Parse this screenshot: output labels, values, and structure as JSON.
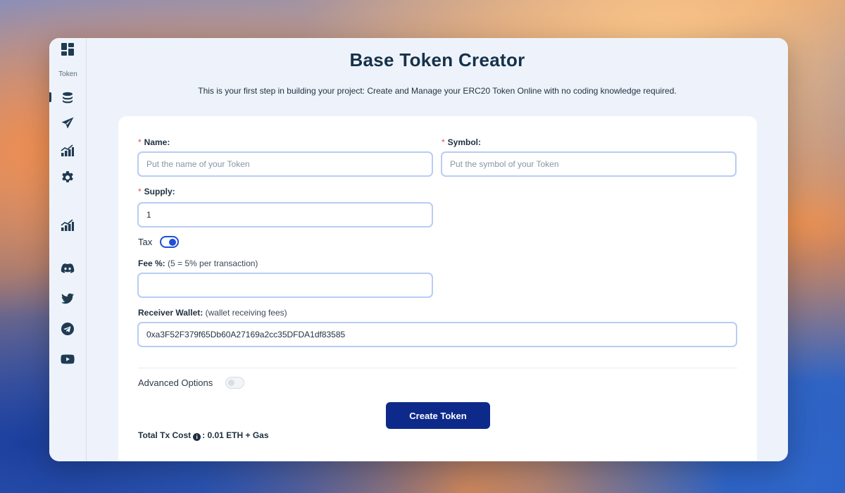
{
  "sidebar": {
    "section_label": "Token",
    "icons": [
      "dashboard-icon",
      "coins-icon",
      "send-icon",
      "chart-icon",
      "gear-icon",
      "chart-icon-2",
      "discord-icon",
      "twitter-icon",
      "telegram-icon",
      "youtube-icon"
    ]
  },
  "header": {
    "title": "Base Token Creator",
    "subtitle": "This is your first step in building your project: Create and Manage your ERC20 Token Online with no coding knowledge required."
  },
  "form": {
    "required_mark": "*",
    "name_label": "Name:",
    "name_placeholder": "Put the name of your Token",
    "symbol_label": "Symbol:",
    "symbol_placeholder": "Put the symbol of your Token",
    "supply_label": "Supply:",
    "supply_value": "1",
    "tax_label": "Tax",
    "tax_enabled": true,
    "fee_label": "Fee %:",
    "fee_hint": "(5 = 5% per transaction)",
    "fee_value": "",
    "receiver_label": "Receiver Wallet:",
    "receiver_hint": "(wallet receiving fees)",
    "receiver_value": "0xa3F52F379f65Db60A27169a2cc35DFDA1df83585",
    "advanced_label": "Advanced Options",
    "advanced_enabled": false,
    "create_button": "Create Token",
    "tx_cost_label": "Total Tx Cost",
    "tx_cost_value": ": 0.01 ETH + Gas"
  },
  "colors": {
    "primary": "#0d2a8a",
    "accent": "#1d4fd8",
    "required": "#e5484d"
  }
}
